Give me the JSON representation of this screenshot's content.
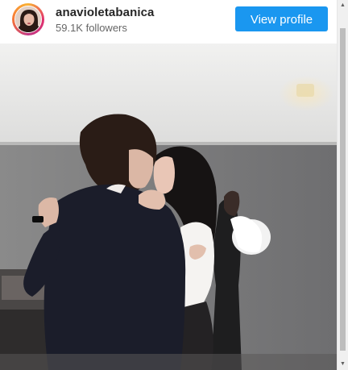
{
  "profile": {
    "username": "anavioletabanica",
    "followers": "59.1K followers",
    "view_profile_label": "View profile"
  },
  "icons": {
    "scroll_up": "triangle-up-icon",
    "scroll_down": "triangle-down-icon"
  },
  "colors": {
    "button_bg": "#1a97f0",
    "username_text": "#262626",
    "followers_text": "#666666"
  }
}
